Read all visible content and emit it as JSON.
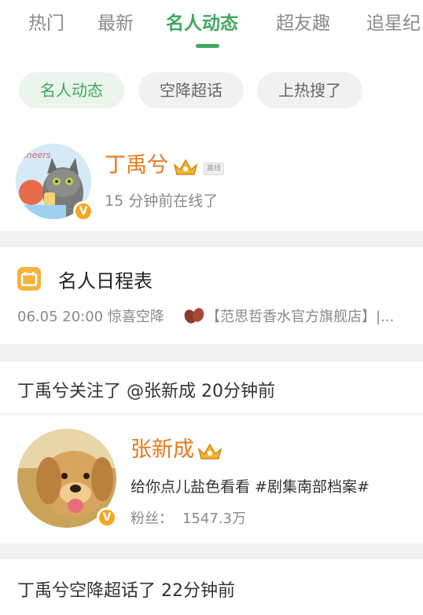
{
  "top_tabs": [
    "热门",
    "最新",
    "名人动态",
    "超友趣",
    "追星纪"
  ],
  "sub_chips": [
    "名人动态",
    "空降超话",
    "上热搜了"
  ],
  "user_card": {
    "name": "丁禹兮",
    "status_tag": "离线",
    "online_status": "15 分钟前在线了",
    "avatar_text": "Cheers"
  },
  "schedule": {
    "title": "名人日程表",
    "item": "06.05 20:00 惊喜空降",
    "store": "【范思哲香水官方旗舰店】|..."
  },
  "activity_follow": "丁禹兮关注了 @张新成 20分钟前",
  "followed_user": {
    "name": "张新成",
    "bio": "给你点儿盐色看看 #剧集南部档案#",
    "fans_label": "粉丝：",
    "fans_value": "1547.3万"
  },
  "activity_supertopic": "丁禹兮空降超话了 22分钟前",
  "colors": {
    "accent_green": "#3fa85f",
    "name_orange": "#e8781b",
    "badge_orange": "#f5a623"
  }
}
